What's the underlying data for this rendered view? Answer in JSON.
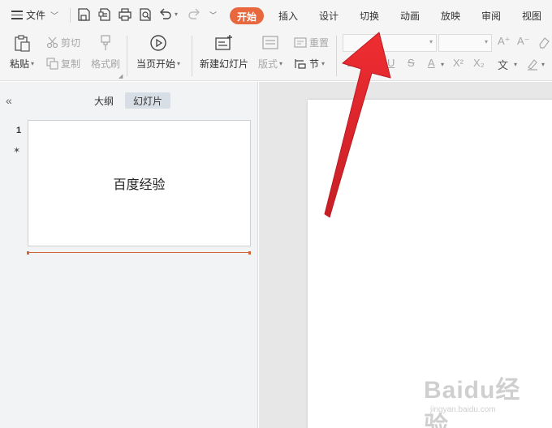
{
  "menu": {
    "label": "文件"
  },
  "tabs": [
    {
      "label": "开始",
      "active": true
    },
    {
      "label": "插入"
    },
    {
      "label": "设计"
    },
    {
      "label": "切换"
    },
    {
      "label": "动画"
    },
    {
      "label": "放映"
    },
    {
      "label": "审阅"
    },
    {
      "label": "视图"
    }
  ],
  "ribbon": {
    "paste": "粘贴",
    "cut": "剪切",
    "copy": "复制",
    "format_painter": "格式刷",
    "from_start": "当页开始",
    "new_slide": "新建幻灯片",
    "layout": "版式",
    "reset": "重置",
    "section": "节"
  },
  "panel": {
    "tab_outline": "大纲",
    "tab_slides": "幻灯片",
    "slide_number": "1",
    "slide_text": "百度经验"
  },
  "watermark": {
    "brand": "Baidu经验",
    "url": "jingyan.baidu.com"
  },
  "colors": {
    "accent_tab": "#e9673d",
    "arrow": "#e3252b"
  }
}
